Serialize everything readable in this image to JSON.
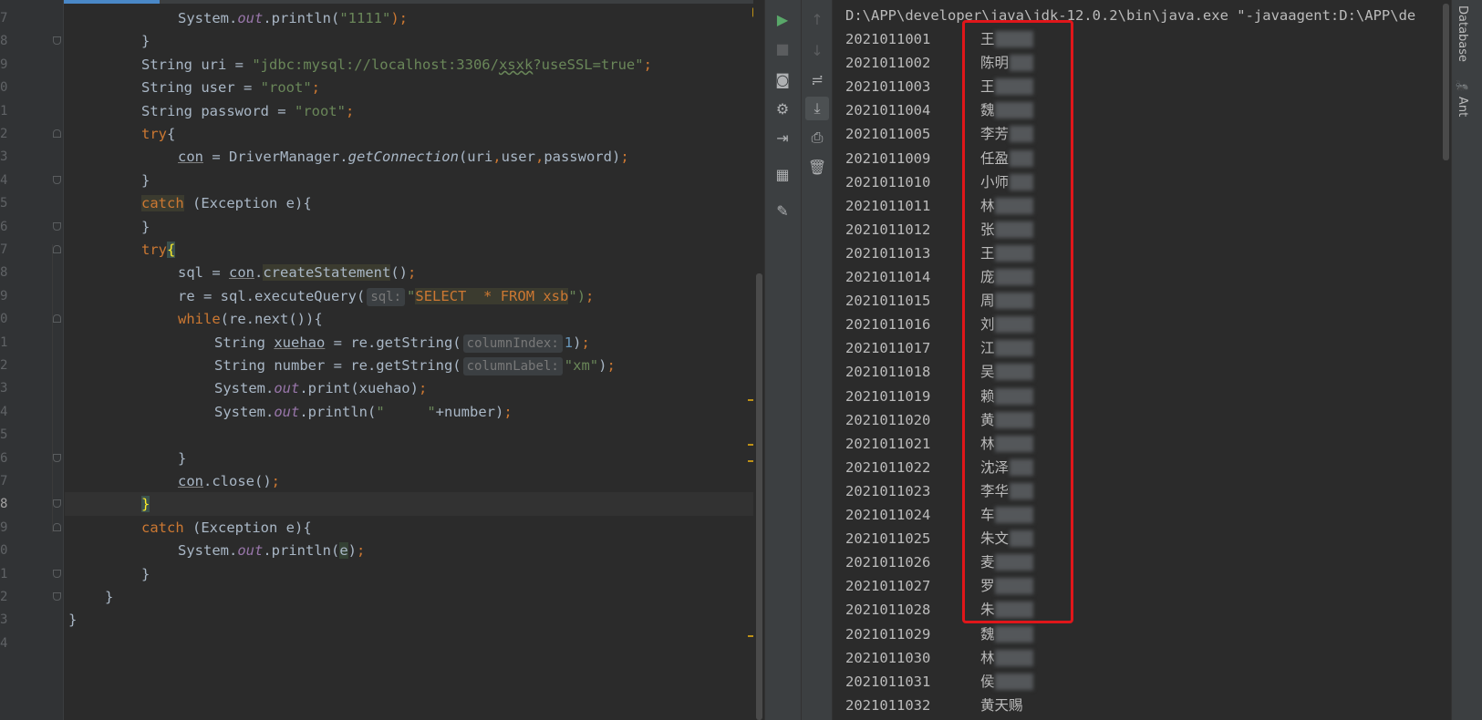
{
  "editor": {
    "lines": [
      {
        "n": "7",
        "tokens": [
          {
            "t": "System.",
            "c": ""
          },
          {
            "t": "out",
            "c": "fld"
          },
          {
            "t": ".println(",
            "c": ""
          },
          {
            "t": "\"1111\"",
            "c": "str"
          },
          {
            "t": ");",
            "c": "kw"
          }
        ]
      },
      {
        "n": "8",
        "tokens": [
          {
            "t": "}",
            "c": ""
          }
        ]
      },
      {
        "n": "9",
        "tokens": [
          {
            "t": "String uri = ",
            "c": ""
          },
          {
            "t": "\"jdbc:mysql://localhost:3306/",
            "c": "str"
          },
          {
            "t": "xsxk",
            "c": "str wavy"
          },
          {
            "t": "?useSSL=true\"",
            "c": "str"
          },
          {
            "t": ";",
            "c": "kw"
          }
        ]
      },
      {
        "n": "0",
        "tokens": [
          {
            "t": "String user = ",
            "c": ""
          },
          {
            "t": "\"root\"",
            "c": "str"
          },
          {
            "t": ";",
            "c": "kw"
          }
        ]
      },
      {
        "n": "1",
        "tokens": [
          {
            "t": "String password = ",
            "c": ""
          },
          {
            "t": "\"root\"",
            "c": "str"
          },
          {
            "t": ";",
            "c": "kw"
          }
        ]
      },
      {
        "n": "2",
        "tokens": [
          {
            "t": "try",
            "c": "kw"
          },
          {
            "t": "{",
            "c": ""
          }
        ]
      },
      {
        "n": "3",
        "tokens": [
          {
            "t": "con",
            "c": "und"
          },
          {
            "t": " = DriverManager.",
            "c": ""
          },
          {
            "t": "getConnection",
            "c": "it"
          },
          {
            "t": "(uri",
            "c": ""
          },
          {
            "t": ",",
            "c": "kw"
          },
          {
            "t": "user",
            "c": ""
          },
          {
            "t": ",",
            "c": "kw"
          },
          {
            "t": "password)",
            "c": ""
          },
          {
            "t": ";",
            "c": "kw"
          }
        ]
      },
      {
        "n": "4",
        "tokens": [
          {
            "t": "}",
            "c": ""
          }
        ]
      },
      {
        "n": "5",
        "tokens": [
          {
            "t": "catch",
            "c": "kw hl"
          },
          {
            "t": " (Exception e){",
            "c": ""
          }
        ]
      },
      {
        "n": "6",
        "tokens": [
          {
            "t": "}",
            "c": ""
          }
        ]
      },
      {
        "n": "7",
        "tokens": [
          {
            "t": "try",
            "c": "kw"
          },
          {
            "t": "{",
            "c": "brace-hl"
          }
        ]
      },
      {
        "n": "8",
        "tokens": [
          {
            "t": "sql = ",
            "c": ""
          },
          {
            "t": "con",
            "c": "und"
          },
          {
            "t": ".",
            "c": ""
          },
          {
            "t": "createStatement",
            "c": "hl"
          },
          {
            "t": "()",
            "c": ""
          },
          {
            "t": ";",
            "c": "kw"
          }
        ]
      },
      {
        "n": "9",
        "tokens": [
          {
            "t": "re = sql.executeQuery(",
            "c": ""
          },
          {
            "t": "sql:",
            "c": "hint"
          },
          {
            "t": "\"",
            "c": "str"
          },
          {
            "t": "SELECT  * FROM xsb",
            "c": "kw hl"
          },
          {
            "t": "\")",
            "c": "str"
          },
          {
            "t": ";",
            "c": "kw"
          }
        ]
      },
      {
        "n": "0",
        "tokens": [
          {
            "t": "while",
            "c": "kw"
          },
          {
            "t": "(re.next()){",
            "c": ""
          }
        ]
      },
      {
        "n": "1",
        "tokens": [
          {
            "t": "String ",
            "c": ""
          },
          {
            "t": "xuehao",
            "c": "und"
          },
          {
            "t": " = re.getString(",
            "c": ""
          },
          {
            "t": "columnIndex:",
            "c": "hint"
          },
          {
            "t": "1",
            "c": "num"
          },
          {
            "t": ")",
            "c": ""
          },
          {
            "t": ";",
            "c": "kw"
          }
        ]
      },
      {
        "n": "2",
        "tokens": [
          {
            "t": "String number = re.getString(",
            "c": ""
          },
          {
            "t": "columnLabel:",
            "c": "hint"
          },
          {
            "t": "\"xm\"",
            "c": "str"
          },
          {
            "t": ")",
            "c": ""
          },
          {
            "t": ";",
            "c": "kw"
          }
        ]
      },
      {
        "n": "3",
        "tokens": [
          {
            "t": "System.",
            "c": ""
          },
          {
            "t": "out",
            "c": "fld"
          },
          {
            "t": ".print(xuehao)",
            "c": ""
          },
          {
            "t": ";",
            "c": "kw"
          }
        ]
      },
      {
        "n": "4",
        "tokens": [
          {
            "t": "System.",
            "c": ""
          },
          {
            "t": "out",
            "c": "fld"
          },
          {
            "t": ".println(",
            "c": ""
          },
          {
            "t": "\"     \"",
            "c": "str"
          },
          {
            "t": "+number)",
            "c": ""
          },
          {
            "t": ";",
            "c": "kw"
          }
        ]
      },
      {
        "n": "5",
        "tokens": []
      },
      {
        "n": "6",
        "tokens": [
          {
            "t": "}",
            "c": ""
          }
        ]
      },
      {
        "n": "7",
        "tokens": [
          {
            "t": "con",
            "c": "und"
          },
          {
            "t": ".close()",
            "c": ""
          },
          {
            "t": ";",
            "c": "kw"
          }
        ]
      },
      {
        "n": "8",
        "tokens": [
          {
            "t": "}",
            "c": "brace-hl"
          }
        ]
      },
      {
        "n": "9",
        "tokens": [
          {
            "t": "catch",
            "c": "kw"
          },
          {
            "t": " (Exception e){",
            "c": ""
          }
        ]
      },
      {
        "n": "0",
        "tokens": [
          {
            "t": "System.",
            "c": ""
          },
          {
            "t": "out",
            "c": "fld"
          },
          {
            "t": ".println(",
            "c": ""
          },
          {
            "t": "e",
            "c": "hl2"
          },
          {
            "t": ")",
            "c": ""
          },
          {
            "t": ";",
            "c": "kw"
          }
        ]
      },
      {
        "n": "1",
        "tokens": [
          {
            "t": "}",
            "c": ""
          }
        ]
      },
      {
        "n": "2",
        "tokens": [
          {
            "t": "}",
            "c": ""
          }
        ]
      },
      {
        "n": "3",
        "tokens": [
          {
            "t": "}",
            "c": ""
          }
        ]
      },
      {
        "n": "4",
        "tokens": []
      }
    ]
  },
  "run_toolbar": {
    "left_icons": [
      "run-icon",
      "stop-icon",
      "camera-icon",
      "debug-settings-icon",
      "exit-icon",
      "layout-icon",
      "pin-icon"
    ],
    "right_icons": [
      "up-arrow-icon",
      "down-arrow-icon",
      "soft-wrap-icon",
      "scroll-to-end-icon",
      "print-icon",
      "trash-icon"
    ]
  },
  "console": {
    "command": "D:\\APP\\developer\\java\\jdk-12.0.2\\bin\\java.exe \"-javaagent:D:\\APP\\de",
    "rows": [
      {
        "id": "2021011001",
        "name": "王"
      },
      {
        "id": "2021011002",
        "name": "陈明"
      },
      {
        "id": "2021011003",
        "name": "王"
      },
      {
        "id": "2021011004",
        "name": "魏"
      },
      {
        "id": "2021011005",
        "name": "李芳"
      },
      {
        "id": "2021011009",
        "name": "任盈"
      },
      {
        "id": "2021011010",
        "name": "小师"
      },
      {
        "id": "2021011011",
        "name": "林"
      },
      {
        "id": "2021011012",
        "name": "张"
      },
      {
        "id": "2021011013",
        "name": "王"
      },
      {
        "id": "2021011014",
        "name": "庞"
      },
      {
        "id": "2021011015",
        "name": "周"
      },
      {
        "id": "2021011016",
        "name": "刘"
      },
      {
        "id": "2021011017",
        "name": "江"
      },
      {
        "id": "2021011018",
        "name": "吴"
      },
      {
        "id": "2021011019",
        "name": "赖"
      },
      {
        "id": "2021011020",
        "name": "黄"
      },
      {
        "id": "2021011021",
        "name": "林"
      },
      {
        "id": "2021011022",
        "name": "沈泽"
      },
      {
        "id": "2021011023",
        "name": "李华"
      },
      {
        "id": "2021011024",
        "name": "车"
      },
      {
        "id": "2021011025",
        "name": "朱文"
      },
      {
        "id": "2021011026",
        "name": "麦"
      },
      {
        "id": "2021011027",
        "name": "罗"
      },
      {
        "id": "2021011028",
        "name": "朱"
      },
      {
        "id": "2021011029",
        "name": "魏"
      },
      {
        "id": "2021011030",
        "name": "林"
      },
      {
        "id": "2021011031",
        "name": "侯"
      },
      {
        "id": "2021011032",
        "name": "黄天赐"
      }
    ]
  },
  "side_tabs": {
    "database": "Database",
    "ant": "Ant"
  },
  "colors": {
    "highlight_box": "#e0161a",
    "keyword": "#cc7832",
    "string": "#6a8759"
  }
}
